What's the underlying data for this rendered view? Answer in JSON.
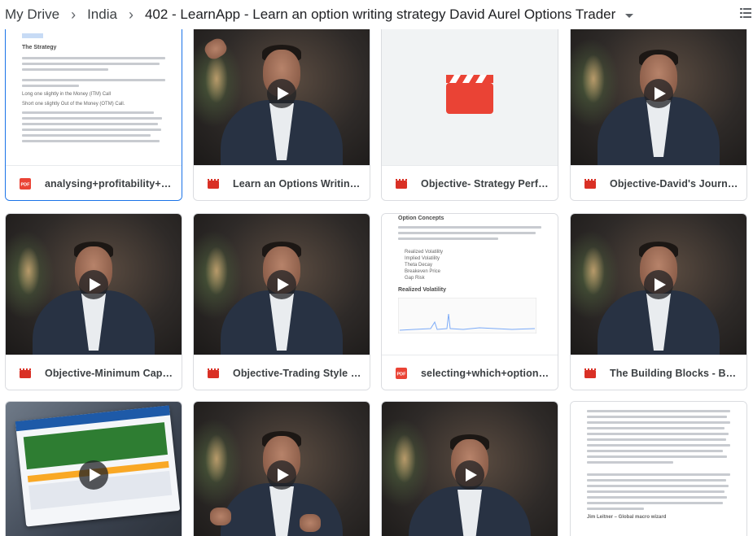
{
  "breadcrumb": {
    "items": [
      "My Drive",
      "India"
    ],
    "current": "402 - LearnApp - Learn an option writing strategy David Aurel Options Trader"
  },
  "icons": {
    "separator": "chevron-right-icon",
    "view": "list-view-icon",
    "pdf": "pdf-icon",
    "video": "video-icon",
    "play": "play-icon"
  },
  "colors": {
    "pdf_red": "#ea4335",
    "video_red": "#d93025",
    "selected_border": "#1a73e8"
  },
  "files": [
    {
      "name": "analysing+profitability+of+a...",
      "type": "pdf",
      "selected": true
    },
    {
      "name": "Learn an Options Writing Str...",
      "type": "video"
    },
    {
      "name": "Objective- Strategy Perform...",
      "type": "video"
    },
    {
      "name": "Objective-David's Journey 1...",
      "type": "video"
    },
    {
      "name": "Objective-Minimum Capital ...",
      "type": "video"
    },
    {
      "name": "Objective-Trading Style 1-1....",
      "type": "video"
    },
    {
      "name": "selecting+which+options+t...",
      "type": "pdf"
    },
    {
      "name": "The Building Blocks - Buyin...",
      "type": "video"
    }
  ],
  "doc_previews": {
    "strategy": {
      "title": "The Strategy",
      "items": [
        "Long one slightly in the Money (ITM) Call",
        "Short one slightly Out of the Money (OTM) Call."
      ]
    },
    "concepts": {
      "title": "Option Concepts",
      "items": [
        "Realized Volatility",
        "Implied Volatility",
        "Theta Decay",
        "Breakeven Price",
        "Gap Risk"
      ],
      "section": "Realized Volatility",
      "heading": "Jim Leitner – Global macro wizard"
    }
  }
}
